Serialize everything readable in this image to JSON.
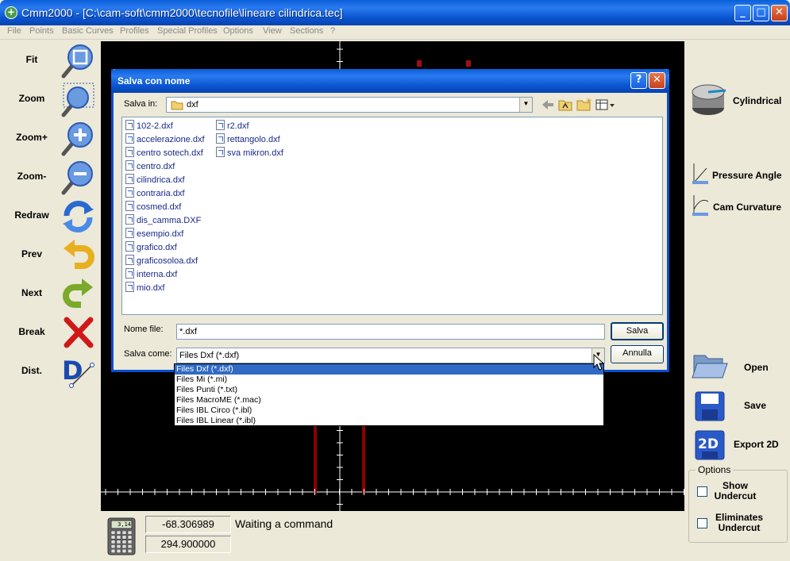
{
  "window": {
    "title": "Cmm2000 - [C:\\cam-soft\\cmm2000\\tecnofile\\lineare cilindrica.tec]",
    "icon": "app-icon",
    "min": "_",
    "max": "□",
    "close": "✕"
  },
  "menu": [
    "File",
    "Points",
    "Basic Curves",
    "Profiles",
    "Special Profiles",
    "Options",
    "View",
    "Sections",
    "?"
  ],
  "left_tools": [
    {
      "label": "Fit",
      "icon": "fit-magnifier-icon"
    },
    {
      "label": "Zoom",
      "icon": "zoom-window-icon"
    },
    {
      "label": "Zoom+",
      "icon": "zoom-in-icon"
    },
    {
      "label": "Zoom-",
      "icon": "zoom-out-icon"
    },
    {
      "label": "Redraw",
      "icon": "redraw-arrows-icon"
    },
    {
      "label": "Prev",
      "icon": "undo-arrow-icon"
    },
    {
      "label": "Next",
      "icon": "redo-arrow-icon"
    },
    {
      "label": "Break",
      "icon": "red-x-icon"
    },
    {
      "label": "Dist.",
      "icon": "distance-measure-icon"
    }
  ],
  "right_tools": {
    "cylindrical": "Cylindrical",
    "pressure_angle": "Pressure Angle",
    "cam_curvature": "Cam Curvature",
    "open": "Open",
    "save": "Save",
    "export2d": "Export 2D",
    "options_title": "Options",
    "show_undercut": "Show\nUndercut",
    "eliminates_undercut": "Eliminates\nUndercut"
  },
  "status": {
    "x": "-68.306989",
    "y": "294.900000",
    "message": "Waiting a command",
    "calc_icon": "calculator-icon",
    "calc_display": "3,14"
  },
  "dialog": {
    "title": "Salva con nome",
    "save_in_label": "Salva in:",
    "save_in_value": "dxf",
    "files_col1": [
      "102-2.dxf",
      "accelerazione.dxf",
      "centro sotech.dxf",
      "centro.dxf",
      "cilindrica.dxf",
      "contraria.dxf",
      "cosmed.dxf",
      "dis_camma.DXF",
      "esempio.dxf",
      "grafico.dxf",
      "graficosoloa.dxf",
      "interna.dxf",
      "mio.dxf"
    ],
    "files_col2": [
      "r2.dxf",
      "rettangolo.dxf",
      "sva mikron.dxf"
    ],
    "filename_label": "Nome file:",
    "filename_value": "*.dxf",
    "savetype_label": "Salva come:",
    "savetype_value": "Files Dxf (*.dxf)",
    "save_button": "Salva",
    "cancel_button": "Annulla",
    "help": "?",
    "close": "✕",
    "type_options": [
      "Files Dxf (*.dxf)",
      "Files Mi (*.mi)",
      "Files Punti (*.txt)",
      "Files MacroME (*.mac)",
      "Files IBL Circo (*.ibl)",
      "Files IBL Linear (*.ibl)"
    ]
  },
  "colors": {
    "accent": "#0a5fd8",
    "selection": "#316ac5",
    "canvas": "#000000",
    "curve": "#8b0000"
  }
}
